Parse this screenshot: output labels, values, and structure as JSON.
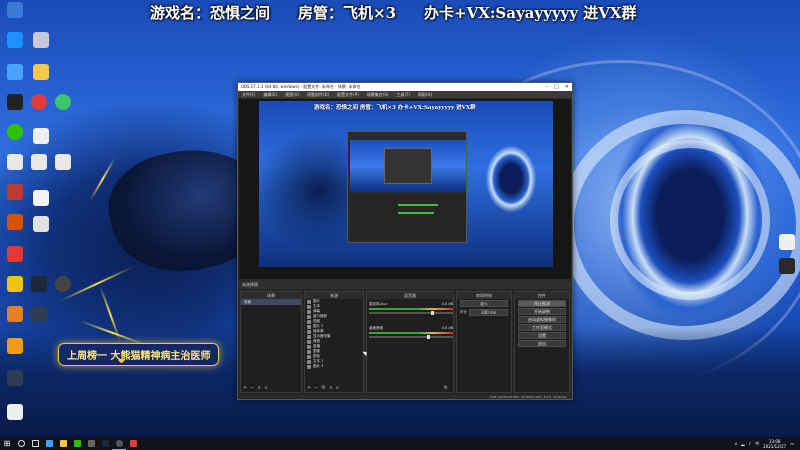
{
  "overlay": {
    "game": "游戏名：恐惧之间",
    "room_admin": "房管：飞机×3",
    "contact": "办卡+VX:Sayayyyyy 进VX群"
  },
  "promo": {
    "text": "上周榜一 大熊猫精神病主治医师",
    "heart": "❤"
  },
  "obs": {
    "title": "OBS 27.1.3 (64-bit, windows) - 配置文件: 未命名 - 场景: 未命名",
    "menu": [
      "文件(F)",
      "编辑(E)",
      "视图(V)",
      "停靠部件(D)",
      "配置文件(P)",
      "场景集合(S)",
      "工具(T)",
      "帮助(H)"
    ],
    "preview_banner": "游戏名：恐惧之间   房管：飞机×3   办卡+VX:Sayayyyyy 进VX群",
    "dock_header": "未选择源",
    "panels": {
      "scenes": {
        "title": "场景",
        "items": [
          "场景"
        ]
      },
      "sources": {
        "title": "来源",
        "items": [
          "图片",
          "文本",
          "弹幕",
          "窗口捕获",
          "视频",
          "图片 2",
          "媒体源",
          "显示器采集",
          "音频",
          "直播",
          "图像",
          "颜色",
          "文本 2",
          "图片 3"
        ]
      },
      "mixer": {
        "title": "混音器",
        "channels": [
          {
            "name": "麦克风/Aux",
            "level": "0.0 dB"
          },
          {
            "name": "桌面音频",
            "level": "0.0 dB"
          }
        ]
      },
      "transitions": {
        "title": "转场特效",
        "type": "淡入",
        "duration_label": "时长",
        "duration": "300 ms"
      },
      "controls": {
        "title": "控件",
        "buttons": [
          "停止推流",
          "开始录制",
          "启动虚拟摄像机",
          "工作室模式",
          "设置",
          "退出"
        ]
      }
    },
    "status": "LIVE: 00:00:00  REC: 00:00:00  CPU: 3.0%, 30.00 fps"
  },
  "taskbar": {
    "start_icon": "windows-logo",
    "clock_time": "13:08",
    "clock_date": "2021/12/27",
    "tray_lang": "中"
  }
}
